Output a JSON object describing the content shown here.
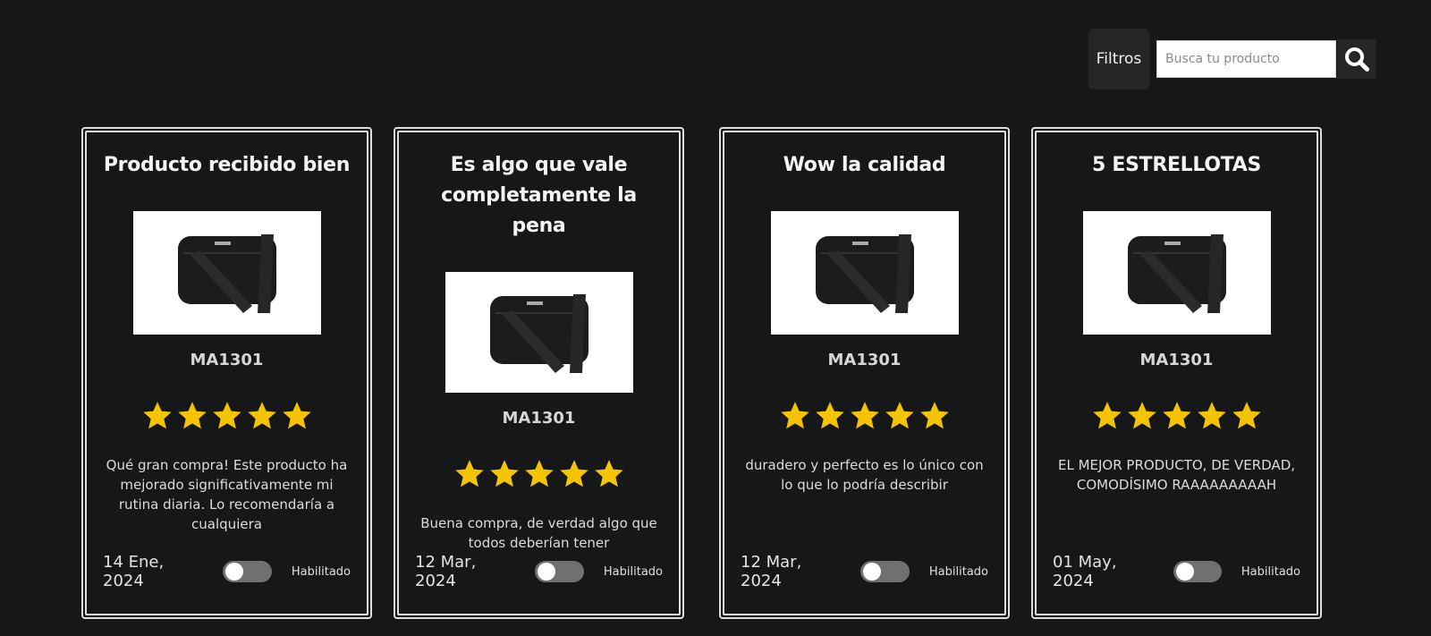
{
  "toolbar": {
    "filters_label": "Filtros",
    "search_placeholder": "Busca tu producto"
  },
  "colors": {
    "background": "#161719",
    "star": "#f5c400",
    "card_border": "#dedede",
    "toggle_off": "#707070"
  },
  "reviews": [
    {
      "title": "Producto recibido bien",
      "product_code": "MA1301",
      "rating": 5,
      "text": "Qué gran compra! Este producto ha mejorado significativamente mi rutina diaria. Lo recomendaría a cualquiera",
      "date": "14 Ene, 2024",
      "toggle_label": "Habilitado"
    },
    {
      "title": "Es algo que vale completamente la pena",
      "product_code": "MA1301",
      "rating": 5,
      "text": "Buena compra, de verdad algo que todos deberían tener",
      "date": "12 Mar, 2024",
      "toggle_label": "Habilitado"
    },
    {
      "title": "Wow la calidad",
      "product_code": "MA1301",
      "rating": 5,
      "text": "duradero y perfecto es lo único con lo que lo podría describir",
      "date": "12 Mar, 2024",
      "toggle_label": "Habilitado"
    },
    {
      "title": "5 ESTRELLOTAS",
      "product_code": "MA1301",
      "rating": 5,
      "text": "EL MEJOR PRODUCTO, DE VERDAD, COMODÍSIMO RAAAAAAAAAH",
      "date": "01 May, 2024",
      "toggle_label": "Habilitado"
    }
  ]
}
